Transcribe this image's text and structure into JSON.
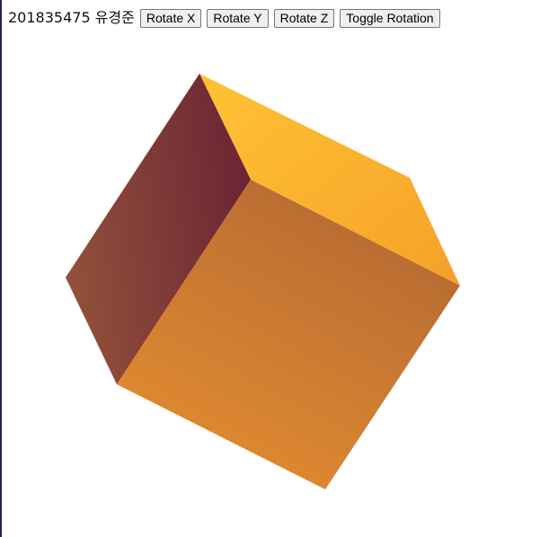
{
  "header": {
    "student_label": "201835475 유경준"
  },
  "toolbar": {
    "rotate_x_label": "Rotate X",
    "rotate_y_label": "Rotate Y",
    "rotate_z_label": "Rotate Z",
    "toggle_rotation_label": "Toggle Rotation"
  },
  "cube": {
    "colors": {
      "top_face_light": "#ffc333",
      "top_face_dark": "#f6a02a",
      "front_face_light": "#e58e30",
      "front_face_dark": "#b16733",
      "left_face_light": "#93503a",
      "left_face_dark": "#6b2535"
    }
  }
}
